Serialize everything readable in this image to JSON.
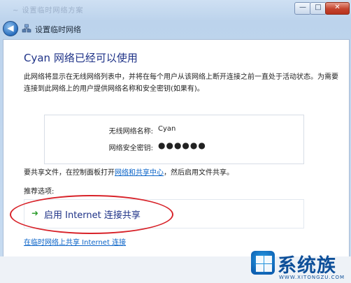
{
  "window": {
    "faded_title": "~ 设置临时网络方案",
    "minimize_label": "—",
    "maximize_label": "□",
    "close_label": "✕"
  },
  "nav": {
    "back_label": "◀",
    "title": "设置临时网络"
  },
  "main": {
    "heading": "Cyan 网络已经可以使用",
    "description": "此网络将显示在无线网络列表中，并将在每个用户从该网络上断开连接之前一直处于活动状态。为需要连接到此网络上的用户提供网络名称和安全密钥(如果有)。",
    "info": {
      "network_name_label": "无线网络名称:",
      "network_name_value": "Cyan",
      "security_key_label": "网络安全密钥:",
      "security_key_value": "●●●●●●"
    },
    "share": {
      "prefix": "要共享文件，在控制面板打开",
      "link": "网络和共享中心",
      "suffix": "，然后启用文件共享。"
    },
    "recommended_label": "推荐选项:",
    "option": {
      "icon": "green-arrow-icon",
      "label": "启用 Internet 连接共享"
    },
    "bottom_link": "在临时网络上共享 Internet 连接"
  },
  "logo": {
    "brand": "系统族",
    "site": "WWW.XITONGZU.COM"
  },
  "colors": {
    "heading": "#1e3287",
    "link": "#0b64c8",
    "highlight_ellipse": "#d8232a",
    "arrow": "#2f9e2f"
  }
}
